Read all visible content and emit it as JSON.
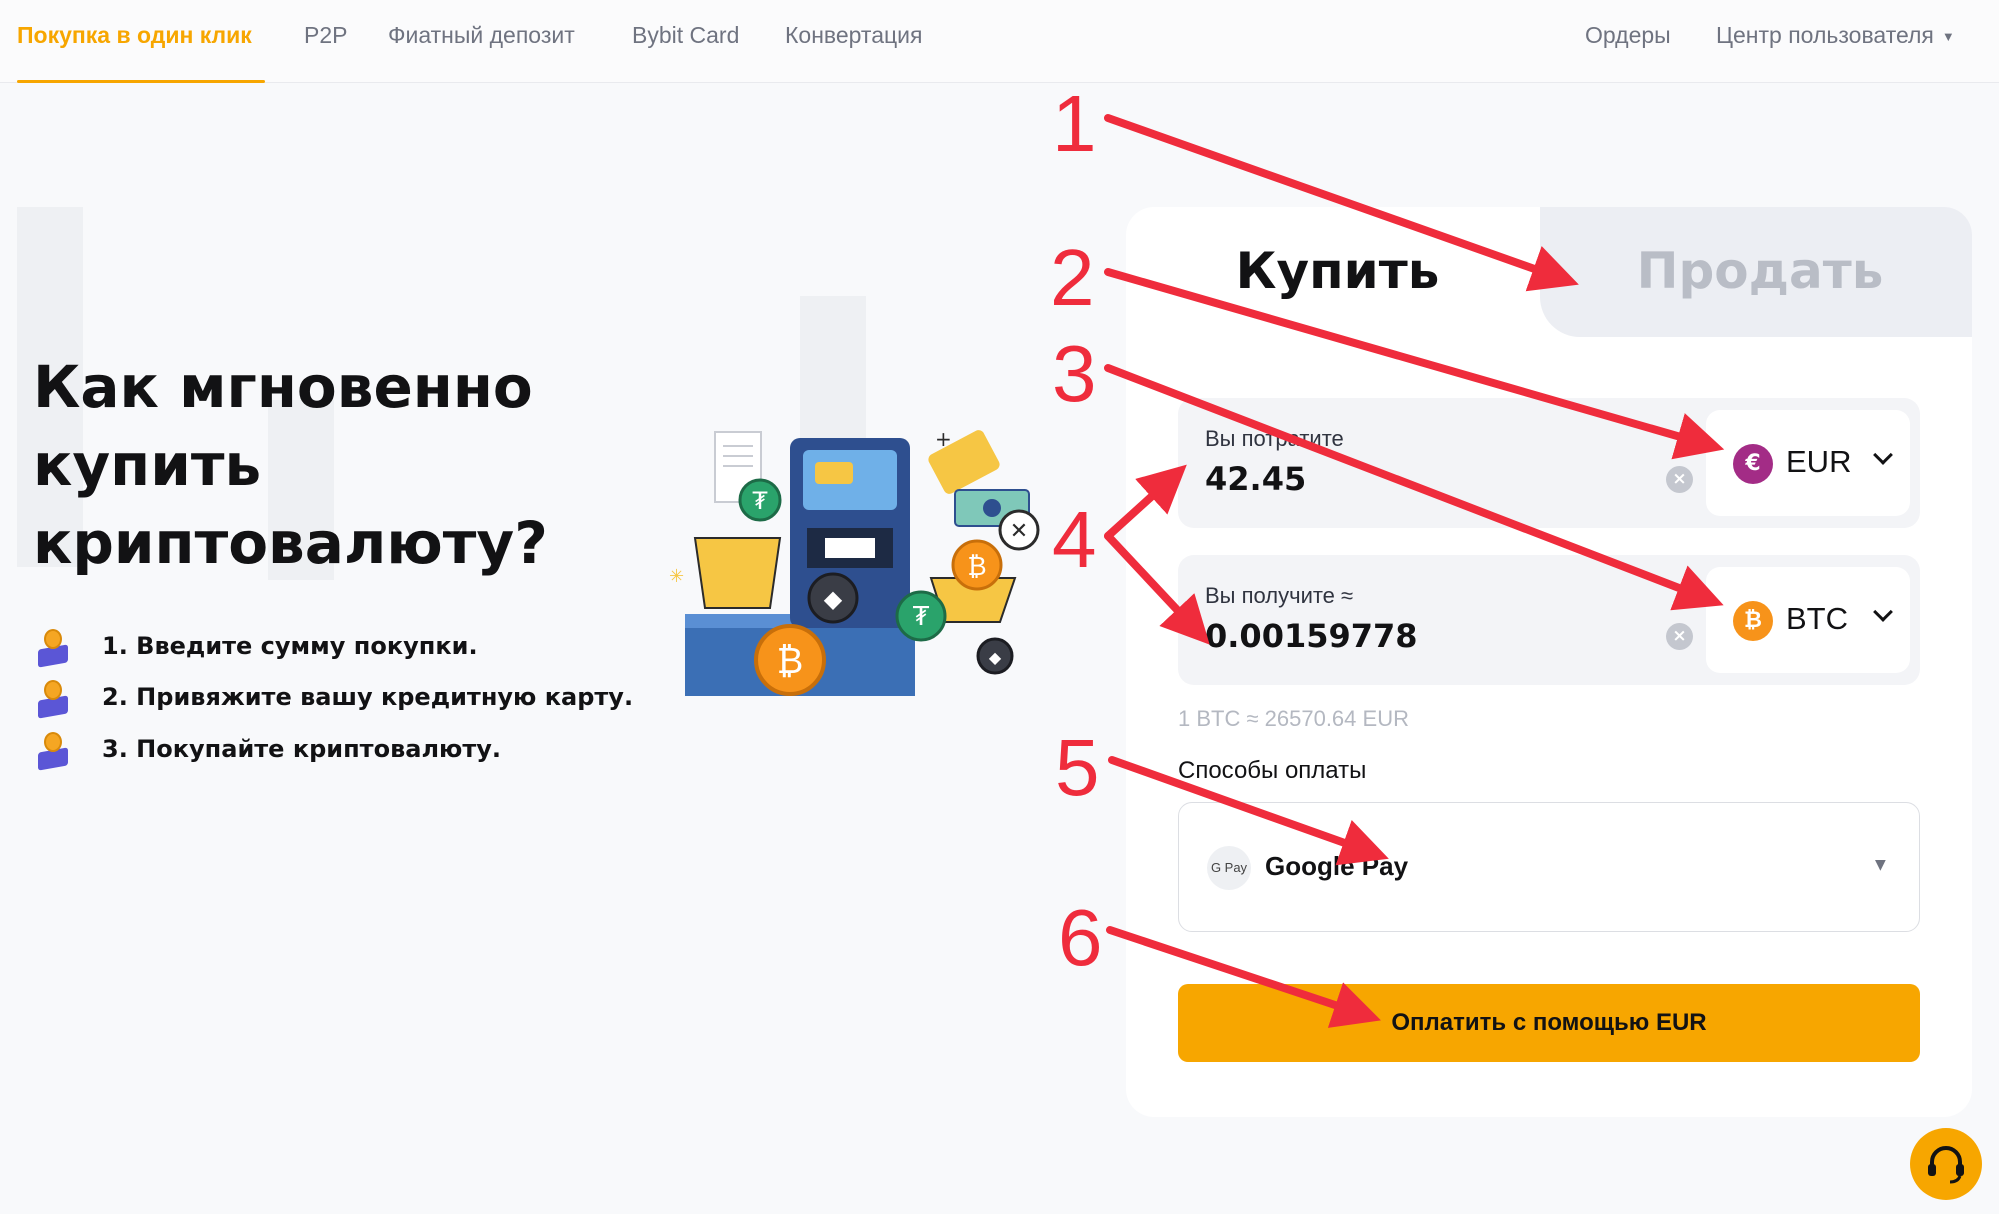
{
  "nav": {
    "tabs": [
      {
        "label": "Покупка в один клик",
        "active": true
      },
      {
        "label": "P2P"
      },
      {
        "label": "Фиатный депозит"
      },
      {
        "label": "Bybit Card"
      },
      {
        "label": "Конвертация"
      }
    ],
    "orders_label": "Ордеры",
    "user_center_label": "Центр пользователя"
  },
  "hero": {
    "title_line1": "Как мгновенно",
    "title_line2": "купить",
    "title_line3": "криптовалюту?",
    "steps": [
      "1. Введите сумму покупки.",
      "2. Привяжите вашу кредитную карту.",
      "3. Покупайте криптовалюту."
    ]
  },
  "trade": {
    "buy_tab": "Купить",
    "sell_tab": "Продать",
    "spend": {
      "label": "Вы потратите",
      "value": "42.45",
      "currency": "EUR",
      "currency_symbol": "€"
    },
    "receive": {
      "label": "Вы получите ≈",
      "value": "0.00159778",
      "currency": "BTC",
      "currency_symbol": "₿"
    },
    "rate": "1 BTC ≈ 26570.64 EUR",
    "payment_methods_title": "Способы оплаты",
    "payment_method": "Google Pay",
    "payment_icon": "G Pay",
    "pay_button": "Оплатить с помощью EUR"
  },
  "annotations": [
    "1",
    "2",
    "3",
    "4",
    "5",
    "6"
  ],
  "colors": {
    "accent": "#f7a600",
    "annotation_red": "#ef2c3c",
    "eur_icon": "#a32c86",
    "btc_icon": "#f7931a"
  },
  "icons": {
    "support": "headset-icon",
    "clear": "clear-icon",
    "dropdown": "chevron-down-icon"
  }
}
